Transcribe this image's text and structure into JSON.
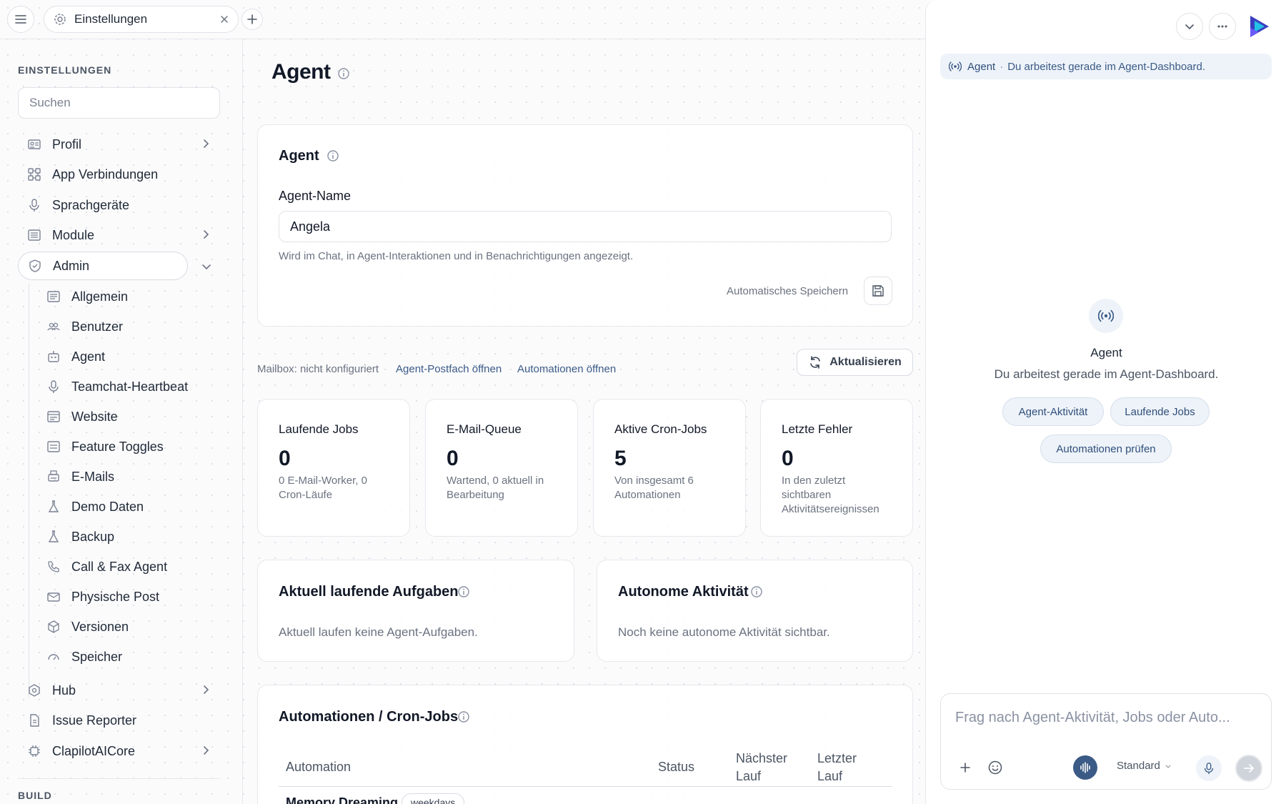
{
  "topbar": {
    "tab_label": "Einstellungen"
  },
  "sidebar": {
    "heading": "EINSTELLUNGEN",
    "search_placeholder": "Suchen",
    "items": [
      {
        "label": "Profil",
        "icon": "id-card-icon"
      },
      {
        "label": "App Verbindungen",
        "icon": "connections-icon"
      },
      {
        "label": "Sprachgeräte",
        "icon": "microphone-icon"
      },
      {
        "label": "Module",
        "icon": "modules-icon"
      },
      {
        "label": "Admin",
        "icon": "shield-icon"
      }
    ],
    "admin_sub_items": [
      {
        "label": "Allgemein",
        "icon": "list-icon"
      },
      {
        "label": "Benutzer",
        "icon": "users-icon"
      },
      {
        "label": "Agent",
        "icon": "robot-icon"
      },
      {
        "label": "Teamchat-Heartbeat",
        "icon": "microphone-icon"
      },
      {
        "label": "Website",
        "icon": "browser-icon"
      },
      {
        "label": "Feature Toggles",
        "icon": "toggles-icon"
      },
      {
        "label": "E-Mails",
        "icon": "mail-printer-icon"
      },
      {
        "label": "Demo Daten",
        "icon": "flask-icon"
      },
      {
        "label": "Backup",
        "icon": "flask-icon"
      },
      {
        "label": "Call & Fax Agent",
        "icon": "phone-icon"
      },
      {
        "label": "Physische Post",
        "icon": "envelope-icon"
      },
      {
        "label": "Versionen",
        "icon": "cube-icon"
      },
      {
        "label": "Speicher",
        "icon": "gauge-icon"
      }
    ],
    "bottom_items": [
      {
        "label": "Hub",
        "icon": "hexagon-icon"
      },
      {
        "label": "Issue Reporter",
        "icon": "document-icon"
      },
      {
        "label": "ClapilotAICore",
        "icon": "chip-icon"
      }
    ],
    "build_heading": "BUILD"
  },
  "main": {
    "title": "Agent",
    "agent_card": {
      "title": "Agent",
      "name_label": "Agent-Name",
      "name_value": "Angela",
      "hint": "Wird im Chat, in Agent-Interaktionen und in Benachrichtigungen angezeigt.",
      "autosave_label": "Automatisches Speichern"
    },
    "mailbox_status": "Mailbox: nicht konfiguriert",
    "link_mailbox": "Agent-Postfach öffnen",
    "link_automations": "Automationen öffnen",
    "refresh_label": "Aktualisieren",
    "stats": [
      {
        "label": "Laufende Jobs",
        "value": "0",
        "desc": "0 E-Mail-Worker, 0 Cron-Läufe"
      },
      {
        "label": "E-Mail-Queue",
        "value": "0",
        "desc": "Wartend, 0 aktuell in Bearbeitung"
      },
      {
        "label": "Aktive Cron-Jobs",
        "value": "5",
        "desc": "Von insgesamt 6 Automationen"
      },
      {
        "label": "Letzte Fehler",
        "value": "0",
        "desc": "In den zuletzt sichtbaren Aktivitätsereignissen"
      }
    ],
    "running_tasks": {
      "title": "Aktuell laufende Aufgaben",
      "empty": "Aktuell laufen keine Agent-Aufgaben."
    },
    "autonomous": {
      "title": "Autonome Aktivität",
      "empty": "Noch keine autonome Aktivität sichtbar."
    },
    "automations": {
      "title": "Automationen / Cron-Jobs",
      "columns": [
        "Automation",
        "Status",
        "Nächster Lauf",
        "Letzter Lauf"
      ],
      "rows": [
        {
          "name": "Memory Dreaming",
          "badge": "weekdays"
        }
      ]
    }
  },
  "right_panel": {
    "banner_title": "Agent",
    "banner_sep": "·",
    "banner_text": "Du arbeitest gerade im Agent-Dashboard.",
    "center_title": "Agent",
    "center_subtitle": "Du arbeitest gerade im Agent-Dashboard.",
    "chips": [
      "Agent-Aktivität",
      "Laufende Jobs",
      "Automationen prüfen"
    ],
    "composer_placeholder": "Frag nach Agent-Aktivität, Jobs oder Auto...",
    "model_label": "Standard"
  },
  "colors": {
    "accent": "#3b5b86",
    "chip_bg": "#eef3f9"
  }
}
